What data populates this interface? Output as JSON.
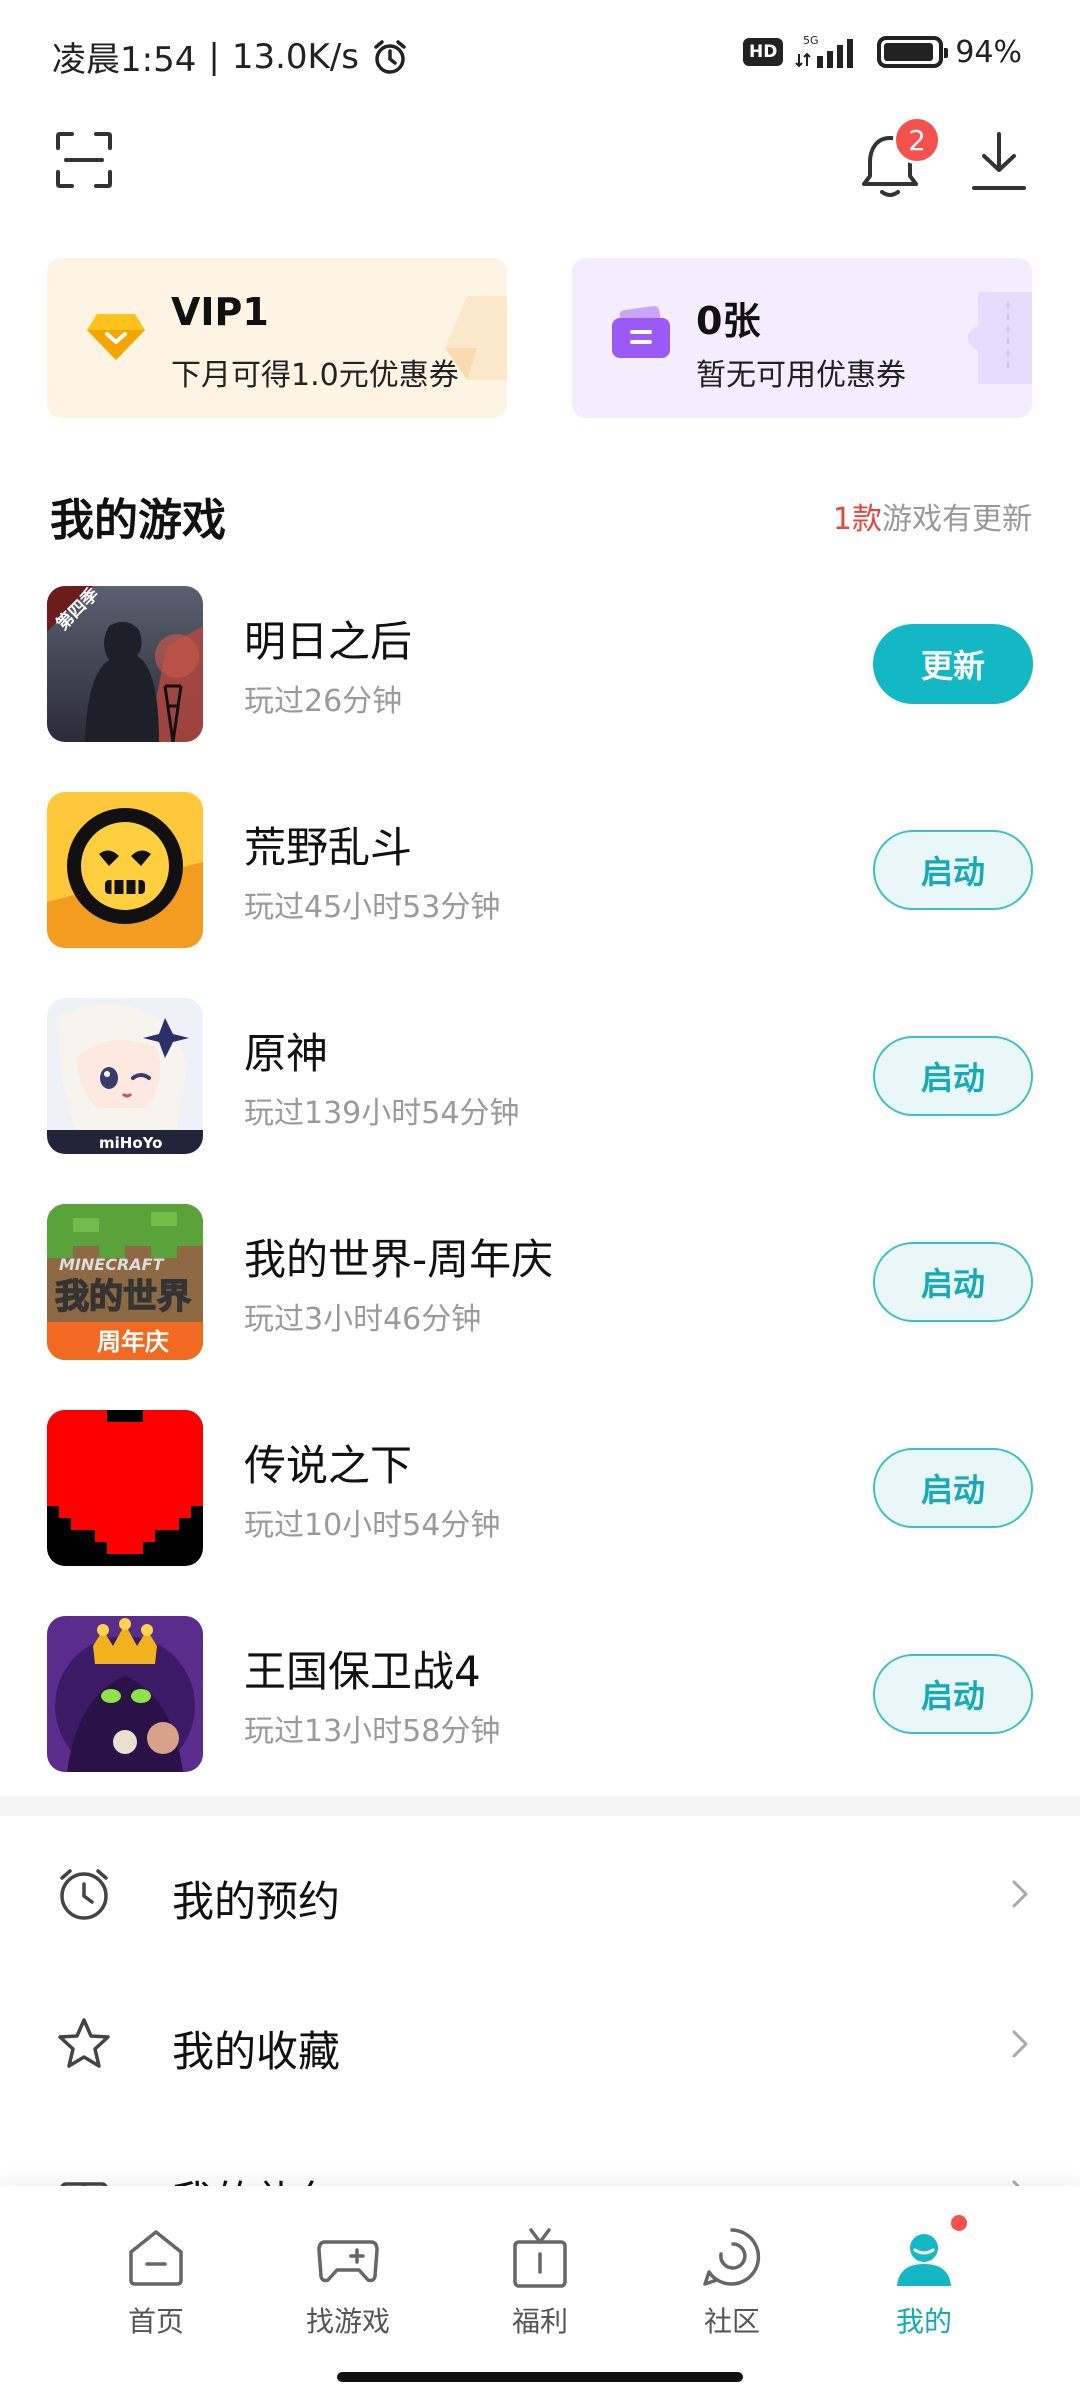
{
  "status_bar": {
    "time": "凌晨1:54",
    "net_speed": "13.0K/s",
    "hd": "HD",
    "network": "5G",
    "battery": "94%",
    "battery_level": 0.94
  },
  "header": {
    "notification_count": "2"
  },
  "cards": {
    "vip": {
      "title": "VIP1",
      "subtitle": "下月可得1.0元优惠券"
    },
    "coupon": {
      "title": "0张",
      "subtitle": "暂无可用优惠券"
    }
  },
  "my_games": {
    "title": "我的游戏",
    "update_count": "1款",
    "update_text": "游戏有更新",
    "items": [
      {
        "name": "明日之后",
        "played": "玩过26分钟",
        "action": "更新"
      },
      {
        "name": "荒野乱斗",
        "played": "玩过45小时53分钟",
        "action": "启动"
      },
      {
        "name": "原神",
        "played": "玩过139小时54分钟",
        "action": "启动"
      },
      {
        "name": "我的世界-周年庆",
        "played": "玩过3小时46分钟",
        "action": "启动"
      },
      {
        "name": "传说之下",
        "played": "玩过10小时54分钟",
        "action": "启动"
      },
      {
        "name": "王国保卫战4",
        "played": "玩过13小时58分钟",
        "action": "启动"
      }
    ]
  },
  "menu": {
    "items": [
      {
        "label": "我的预约"
      },
      {
        "label": "我的收藏"
      },
      {
        "label": "我的礼包"
      }
    ]
  },
  "icon_text": {
    "mingri_badge": "第四季",
    "genshin_logo": "miHoYo",
    "minecraft_logo": "MINECRAFT",
    "minecraft_cn": "我的世界",
    "minecraft_banner": "周年庆"
  },
  "bottom_nav": {
    "items": [
      {
        "label": "首页"
      },
      {
        "label": "找游戏"
      },
      {
        "label": "福利"
      },
      {
        "label": "社区"
      },
      {
        "label": "我的"
      }
    ]
  },
  "colors": {
    "accent": "#14b8c4",
    "badge": "#f4504c",
    "vip_bg": "#fef4e4",
    "coupon_bg": "#f4edfd"
  }
}
